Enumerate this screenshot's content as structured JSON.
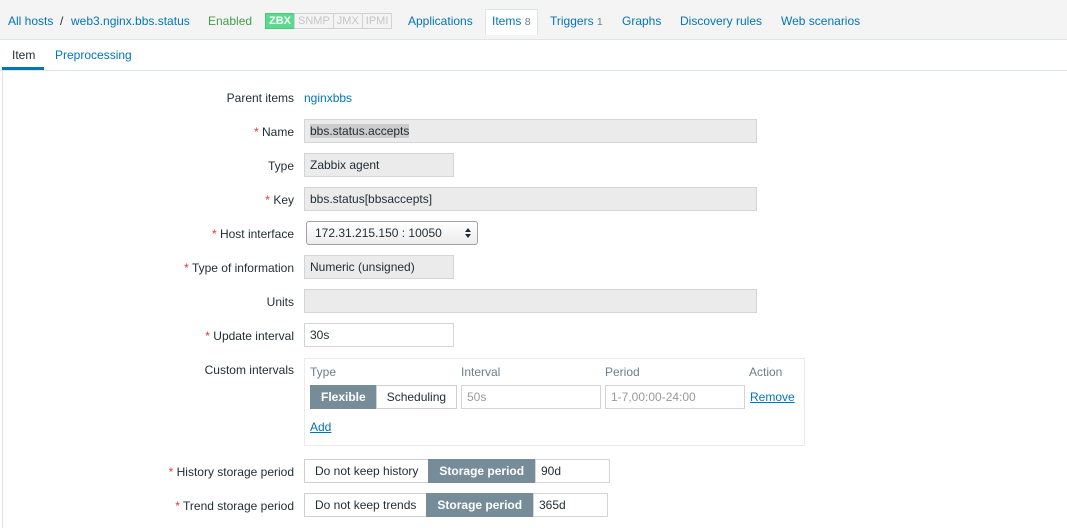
{
  "nav": {
    "all_hosts": "All hosts",
    "separator": "/",
    "host": "web3.nginx.bbs.status",
    "status": "Enabled",
    "availability": [
      "ZBX",
      "SNMP",
      "JMX",
      "IPMI"
    ],
    "applications": "Applications",
    "items": "Items",
    "items_count": "8",
    "triggers": "Triggers",
    "triggers_count": "1",
    "graphs": "Graphs",
    "discovery_rules": "Discovery rules",
    "web_scenarios": "Web scenarios"
  },
  "tabs": {
    "item": "Item",
    "preprocessing": "Preprocessing"
  },
  "form": {
    "parent_items_label": "Parent items",
    "parent_items_value": "nginxbbs",
    "name_label": "Name",
    "name_value": "bbs.status.accepts",
    "type_label": "Type",
    "type_value": "Zabbix agent",
    "key_label": "Key",
    "key_value": "bbs.status[bbsaccepts]",
    "host_interface_label": "Host interface",
    "host_interface_value": "172.31.215.150 : 10050",
    "type_of_info_label": "Type of information",
    "type_of_info_value": "Numeric (unsigned)",
    "units_label": "Units",
    "units_value": "",
    "update_interval_label": "Update interval",
    "update_interval_value": "30s",
    "custom_intervals_label": "Custom intervals",
    "history_label": "History storage period",
    "history_option_off": "Do not keep history",
    "history_option_on": "Storage period",
    "history_value": "90d",
    "trend_label": "Trend storage period",
    "trend_option_off": "Do not keep trends",
    "trend_option_on": "Storage period",
    "trend_value": "365d"
  },
  "custom_intervals": {
    "col_type": "Type",
    "col_interval": "Interval",
    "col_period": "Period",
    "col_action": "Action",
    "type_flexible": "Flexible",
    "type_scheduling": "Scheduling",
    "interval_placeholder": "50s",
    "period_placeholder": "1-7,00:00-24:00",
    "remove": "Remove",
    "add": "Add"
  },
  "colors": {
    "link": "#0275b8",
    "enabled": "#429e47",
    "required": "#e33734",
    "zbx_available": "#59db8f",
    "segment_active": "#768d99"
  }
}
